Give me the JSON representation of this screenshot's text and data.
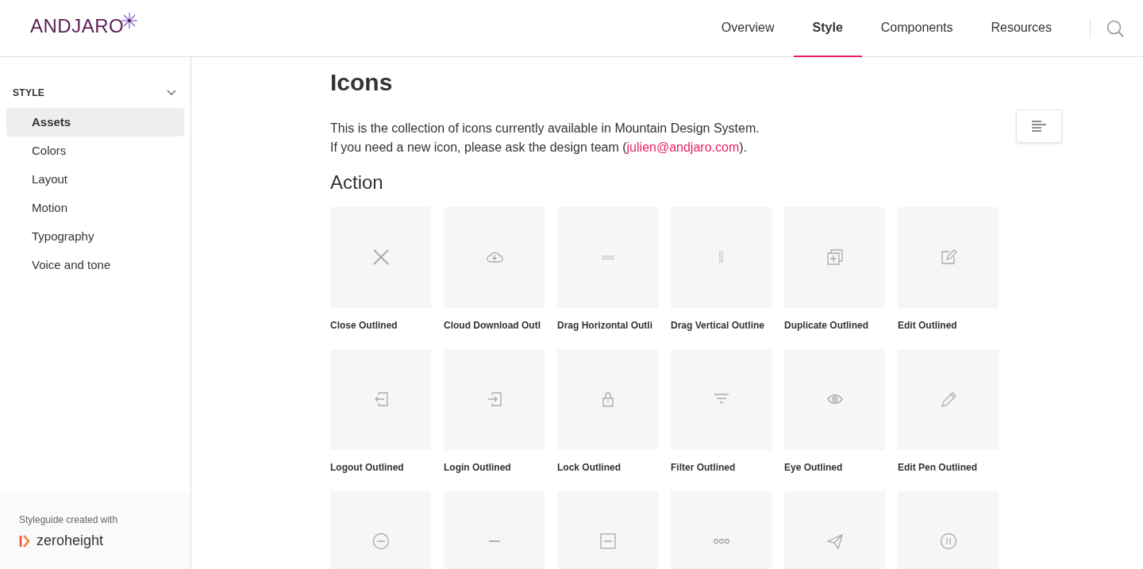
{
  "header": {
    "logo": "ANDJARO",
    "nav": [
      {
        "label": "Overview",
        "selected": false
      },
      {
        "label": "Style",
        "selected": true
      },
      {
        "label": "Components",
        "selected": false
      },
      {
        "label": "Resources",
        "selected": false
      }
    ]
  },
  "sidebar": {
    "section": {
      "title": "STYLE",
      "expanded": true
    },
    "items": [
      {
        "label": "Assets",
        "selected": true
      },
      {
        "label": "Colors",
        "selected": false
      },
      {
        "label": "Layout",
        "selected": false
      },
      {
        "label": "Motion",
        "selected": false
      },
      {
        "label": "Typography",
        "selected": false
      },
      {
        "label": "Voice and tone",
        "selected": false
      }
    ],
    "footer": {
      "caption": "Styleguide created with",
      "brand": "zeroheight"
    }
  },
  "content": {
    "title": "Icons",
    "intro_line_1": "This is the collection of icons currently available in Mountain Design System.",
    "intro_line_2_before": "If you need a new icon, please ask the design team (",
    "intro_link": "julien@andjaro.com",
    "intro_line_2_after": ").",
    "section": "Action",
    "icons": [
      {
        "kind": "close",
        "label": "Close Outlined"
      },
      {
        "kind": "cloud-download",
        "label": "Cloud Download Outl"
      },
      {
        "kind": "drag-horizontal",
        "label": "Drag Horizontal Outli"
      },
      {
        "kind": "drag-vertical",
        "label": "Drag Vertical Outline"
      },
      {
        "kind": "duplicate",
        "label": "Duplicate Outlined"
      },
      {
        "kind": "edit",
        "label": "Edit Outlined"
      },
      {
        "kind": "logout",
        "label": "Logout Outlined"
      },
      {
        "kind": "login",
        "label": "Login Outlined"
      },
      {
        "kind": "lock",
        "label": "Lock Outlined"
      },
      {
        "kind": "filter",
        "label": "Filter Outlined"
      },
      {
        "kind": "eye",
        "label": "Eye Outlined"
      },
      {
        "kind": "pen",
        "label": "Edit Pen Outlined"
      },
      {
        "kind": "minus-circle"
      },
      {
        "kind": "minus"
      },
      {
        "kind": "minus-square"
      },
      {
        "kind": "more"
      },
      {
        "kind": "send"
      },
      {
        "kind": "pause-circle"
      }
    ]
  }
}
